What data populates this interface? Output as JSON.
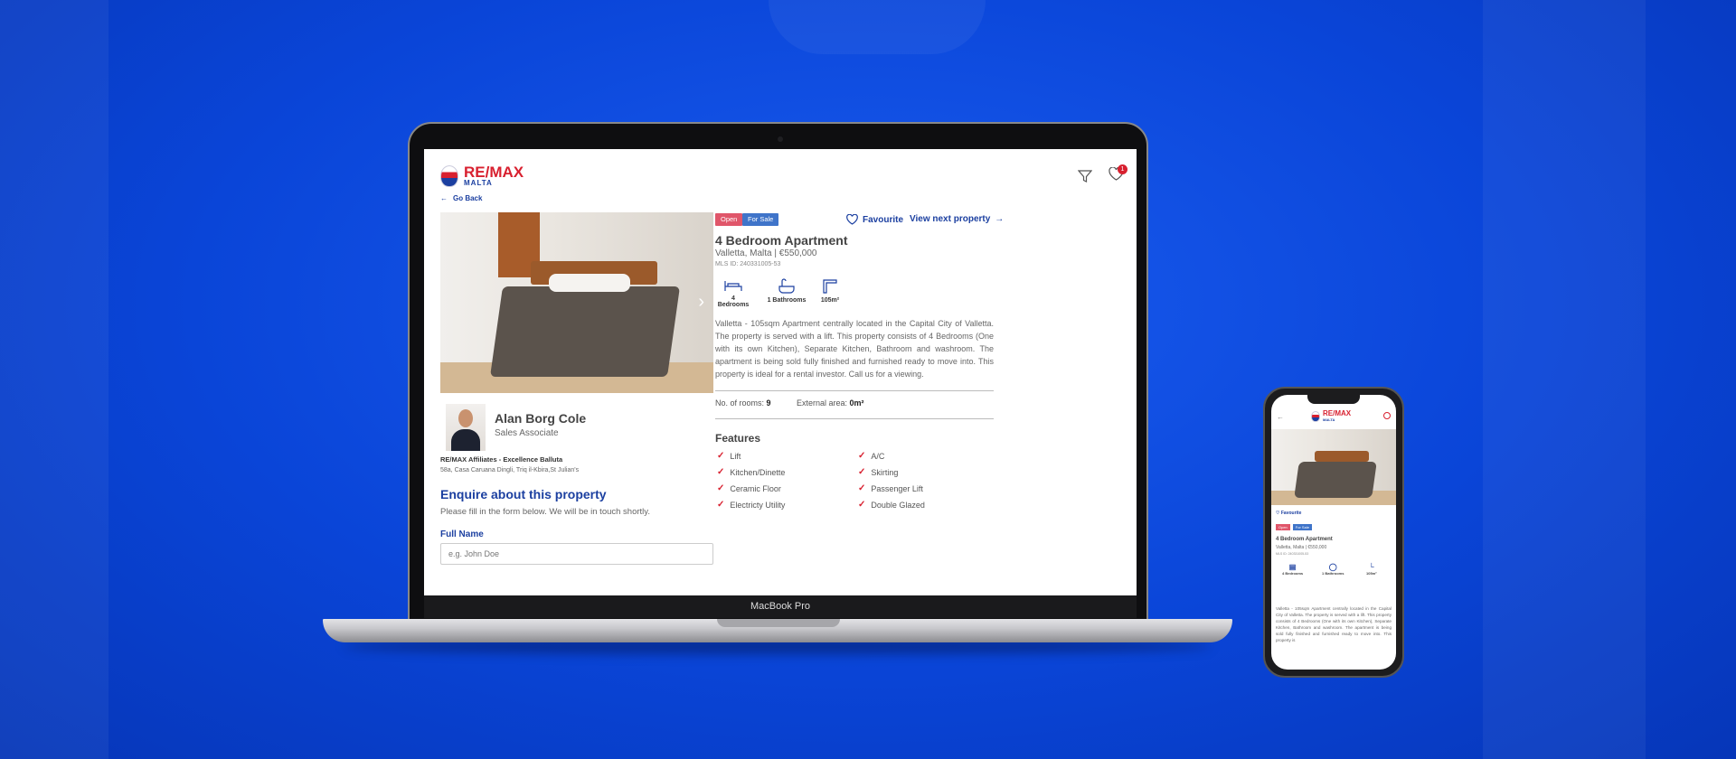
{
  "laptop": {
    "label": "MacBook Pro"
  },
  "header": {
    "logo": "RE/MAX",
    "logo_sub": "MALTA",
    "wishlist_count": "1",
    "go_back": "Go Back"
  },
  "property": {
    "tags": [
      "Open",
      "For Sale"
    ],
    "favourite": "Favourite",
    "next": "View next property",
    "title": "4 Bedroom Apartment",
    "location": "Valletta, Malta | €550,000",
    "mls": "MLS ID: 240331005-53",
    "specs": [
      {
        "label": "4 Bedrooms",
        "icon": "bed-icon"
      },
      {
        "label": "1 Bathrooms",
        "icon": "bath-icon"
      },
      {
        "label": "105m²",
        "icon": "area-icon"
      }
    ],
    "description": "Valletta - 105sqm Apartment centrally located in the Capital City of Valletta. The property is served with a lift. This property consists of 4 Bedrooms (One with its own Kitchen), Separate Kitchen, Bathroom and washroom. The apartment is being sold fully finished and furnished ready to move into. This property is ideal for a rental investor. Call us for a viewing.",
    "rooms_label": "No. of rooms:",
    "rooms_value": "9",
    "area_label": "External area:",
    "area_value": "0m²",
    "features_title": "Features",
    "features": [
      "Lift",
      "A/C",
      "Kitchen/Dinette",
      "Skirting",
      "Ceramic Floor",
      "Passenger Lift",
      "Electricty Utility",
      "Double Glazed"
    ]
  },
  "agent": {
    "name": "Alan Borg Cole",
    "role": "Sales Associate",
    "office": "RE/MAX Affiliates - Excellence Balluta",
    "address": "58a, Casa Caruana Dingli, Triq il-Kbira,St Julian's"
  },
  "enquiry": {
    "title": "Enquire about this property",
    "subtitle": "Please fill in the form below. We will be in touch shortly.",
    "full_name_label": "Full Name",
    "full_name_placeholder": "e.g. John Doe"
  },
  "mobile": {
    "favourite": "Favourite",
    "tags": [
      "Open",
      "For Sale"
    ],
    "title": "4 Bedroom Apartment",
    "location": "Valletta, Malta | €550,000",
    "mls": "MLS ID: 240331005-53",
    "specs": [
      "4 Bedrooms",
      "1 Bathrooms",
      "105m²"
    ],
    "description": "Valletta - 105sqm Apartment centrally located in the Capital City of Valletta. The property is served with a lift. This property consists of 4 Bedrooms (One with its own Kitchen), Separate Kitchen, Bathroom and washroom. The apartment is being sold fully finished and furnished ready to move into. This property is"
  },
  "colors": {
    "background": "#0b4fe0",
    "brand_blue": "#1b3fa0",
    "brand_red": "#d8202f",
    "tag_open": "#e0566a",
    "tag_sale": "#3f74c9"
  }
}
